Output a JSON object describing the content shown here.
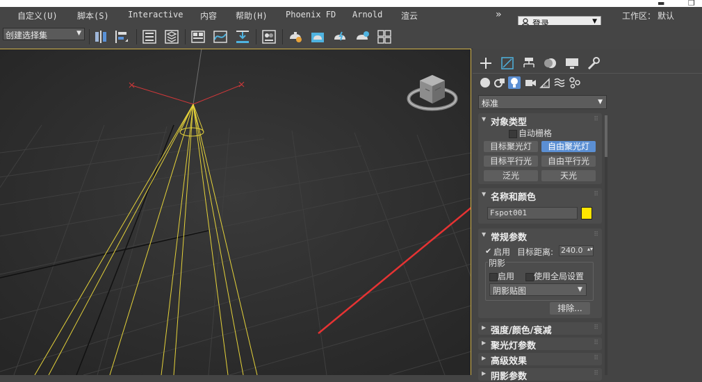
{
  "window": {
    "minimize_glyph": "▬",
    "restore_glyph": "❐"
  },
  "menu": {
    "items": [
      "自定义(U)",
      "脚本(S)",
      "Interactive",
      "内容",
      "帮助(H)",
      "Phoenix FD",
      "Arnold",
      "渲云"
    ],
    "overflow_glyph": "»",
    "login_label": "登录",
    "workspace_label": "工作区：",
    "workspace_value": "默认"
  },
  "toolbar": {
    "selection_set_value": "创建选择集",
    "icons": [
      "mirror-icon",
      "align-icon",
      "scene-explorer-icon",
      "layer-explorer-icon",
      "ribbon-icon",
      "curve-editor-icon",
      "dope-sheet-icon",
      "material-editor-icon",
      "render-setup-icon",
      "rendered-frame-icon",
      "render-icon",
      "activeshade-icon",
      "render-gallery-icon"
    ]
  },
  "viewport": {
    "name": "perspective-viewport",
    "highlight_color": "#d1b24a",
    "light_color": "#e6d33a",
    "annotation_arrow_color": "#e63333"
  },
  "command_panel": {
    "tabs": [
      "create-icon",
      "modify-icon",
      "hierarchy-icon",
      "motion-icon",
      "display-icon",
      "utilities-icon"
    ],
    "type_buttons": [
      "geometry-icon",
      "shapes-icon",
      "lights-icon",
      "cameras-icon",
      "helpers-icon",
      "space-warps-icon",
      "systems-icon"
    ],
    "category_value": "标准",
    "object_type": {
      "title": "对象类型",
      "autogrid_label": "自动栅格",
      "buttons": [
        "目标聚光灯",
        "自由聚光灯",
        "目标平行光",
        "自由平行光",
        "泛光",
        "天光"
      ],
      "active_button": "自由聚光灯"
    },
    "name_color": {
      "title": "名称和颜色",
      "name_value": "Fspot001",
      "swatch_color": "#ffe600"
    },
    "general": {
      "title": "常规参数",
      "enable_label": "启用",
      "target_dist_label": "目标距离:",
      "target_dist_value": "240.0",
      "shadow_group_label": "阴影",
      "shadow_enable_label": "启用",
      "global_settings_label": "使用全局设置",
      "shadow_type_value": "阴影贴图",
      "exclude_label": "排除..."
    },
    "collapsed_rollouts": [
      "强度/颜色/衰减",
      "聚光灯参数",
      "高级效果",
      "阴影参数"
    ]
  }
}
